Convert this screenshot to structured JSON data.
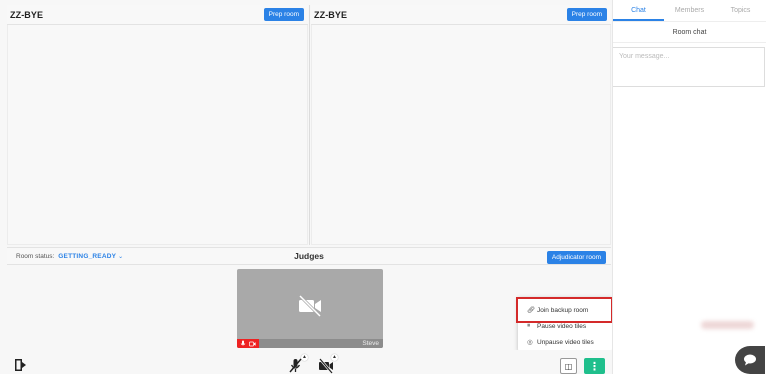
{
  "rooms": [
    {
      "title": "ZZ-BYE",
      "button": "Prep room"
    },
    {
      "title": "ZZ-BYE",
      "button": "Prep room"
    }
  ],
  "judges_bar": {
    "status_label": "Room status:",
    "status_value": "GETTING_READY",
    "title": "Judges",
    "adjudicator_button": "Adjudicator room"
  },
  "video_tile": {
    "name": "Steve"
  },
  "menu": {
    "items": [
      {
        "label": "Join backup room",
        "icon": "link-icon"
      },
      {
        "label": "Pause video tiles",
        "icon": "pause-icon"
      },
      {
        "label": "Unpause video tiles",
        "icon": "play-circle-icon"
      }
    ]
  },
  "sidebar": {
    "tabs": [
      "Chat",
      "Members",
      "Topics"
    ],
    "active_tab": "Chat",
    "room_chat_label": "Room chat",
    "message_placeholder": "Your message..."
  },
  "colors": {
    "accent": "#2b82e6",
    "danger": "#d42a2a",
    "success": "#1fbf8c"
  }
}
